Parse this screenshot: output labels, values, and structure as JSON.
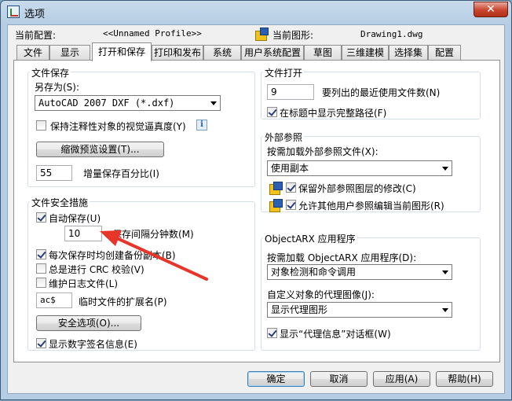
{
  "window": {
    "title": "选项",
    "close_glyph": "✕"
  },
  "profile": {
    "label": "当前配置:",
    "value": "<<Unnamed Profile>>",
    "drawing_label": "当前图形:",
    "drawing_value": "Drawing1.dwg"
  },
  "tabs": [
    {
      "label": "文件"
    },
    {
      "label": "显示"
    },
    {
      "label": "打开和保存"
    },
    {
      "label": "打印和发布"
    },
    {
      "label": "系统"
    },
    {
      "label": "用户系统配置"
    },
    {
      "label": "草图"
    },
    {
      "label": "三维建模"
    },
    {
      "label": "选择集"
    },
    {
      "label": "配置"
    }
  ],
  "file_save": {
    "group_title": "文件保存",
    "save_as_label": "另存为(S):",
    "save_as_value": "AutoCAD 2007 DXF (*.dxf)",
    "annotative_label": "保持注释性对象的视觉逼真度(Y)",
    "info_glyph": "i",
    "thumbnail_button": "缩微预览设置(T)...",
    "incremental_value": "55",
    "incremental_label": "增量保存百分比(I)"
  },
  "file_safety": {
    "group_title": "文件安全措施",
    "autosave_label": "自动保存(U)",
    "interval_value": "10",
    "interval_label": "保存间隔分钟数(M)",
    "backup_label": "每次保存时均创建备份副本(B)",
    "crc_label": "总是进行 CRC 校验(V)",
    "log_label": "维护日志文件(L)",
    "temp_ext_value": "ac$",
    "temp_ext_label": "临时文件的扩展名(P)",
    "security_button": "安全选项(O)...",
    "digital_sig_label": "显示数字签名信息(E)"
  },
  "file_open": {
    "group_title": "文件打开",
    "recent_value": "9",
    "recent_label": "要列出的最近使用文件数(N)",
    "full_path_label": "在标题中显示完整路径(F)"
  },
  "xref": {
    "group_title": "外部参照",
    "demand_load_label": "按需加载外部参照文件(X):",
    "demand_load_value": "使用副本",
    "retain_layer_label": "保留外部参照图层的修改(C)",
    "allow_edit_label": "允许其他用户参照编辑当前图形(R)"
  },
  "arx": {
    "group_title": "ObjectARX 应用程序",
    "demand_load_label": "按需加载 ObjectARX 应用程序(D):",
    "demand_load_value": "对象检测和命令调用",
    "proxy_label": "自定义对象的代理图像(J):",
    "proxy_value": "显示代理图形",
    "proxy_dialog_label": "显示“代理信息”对话框(W)"
  },
  "footer": {
    "ok": "确定",
    "cancel": "取消",
    "apply": "应用(A)",
    "help": "帮助(H)"
  },
  "colors": {
    "annotation_arrow": "#e8352a"
  }
}
